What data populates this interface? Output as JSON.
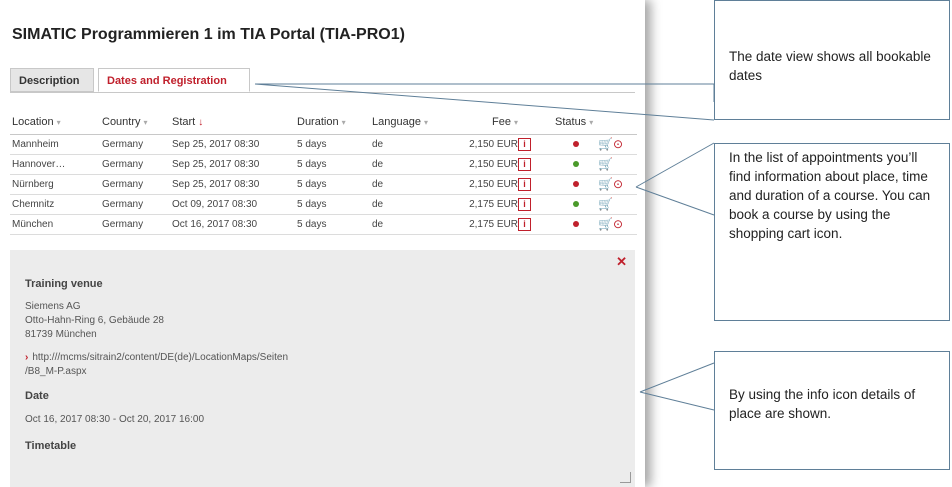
{
  "page_title": "SIMATIC Programmieren 1 im TIA Portal (TIA-PRO1)",
  "tabs": [
    {
      "label": "Description",
      "active": false
    },
    {
      "label": "Dates and Registration",
      "active": true
    }
  ],
  "table": {
    "headers": [
      "Location",
      "Country",
      "Start",
      "Duration",
      "Language",
      "Fee",
      "Status"
    ],
    "rows": [
      {
        "location": "Mannheim",
        "country": "Germany",
        "start": "Sep 25, 2017 08:30",
        "duration": "5 days",
        "language": "de",
        "fee": "2,150 EUR",
        "status_color": "#c0202c",
        "cart": "🛒⊙"
      },
      {
        "location": "Hannover…",
        "country": "Germany",
        "start": "Sep 25, 2017 08:30",
        "duration": "5 days",
        "language": "de",
        "fee": "2,150 EUR",
        "status_color": "#4a9a2a",
        "cart": "🛒"
      },
      {
        "location": "Nürnberg",
        "country": "Germany",
        "start": "Sep 25, 2017 08:30",
        "duration": "5 days",
        "language": "de",
        "fee": "2,150 EUR",
        "status_color": "#c0202c",
        "cart": "🛒⊙"
      },
      {
        "location": "Chemnitz",
        "country": "Germany",
        "start": "Oct 09, 2017 08:30",
        "duration": "5 days",
        "language": "de",
        "fee": "2,175 EUR",
        "status_color": "#4a9a2a",
        "cart": "🛒"
      },
      {
        "location": "München",
        "country": "Germany",
        "start": "Oct 16, 2017 08:30",
        "duration": "5 days",
        "language": "de",
        "fee": "2,175 EUR",
        "status_color": "#c0202c",
        "cart": "🛒⊙"
      }
    ]
  },
  "detail": {
    "venue_heading": "Training venue",
    "venue_lines": [
      "Siemens AG",
      "Otto-Hahn-Ring 6, Gebäude 28",
      "81739 München"
    ],
    "link_line1": "http:///mcms/sitrain2/content/DE(de)/LocationMaps/Seiten",
    "link_line2": "/B8_M-P.aspx",
    "date_heading": "Date",
    "date_value": "Oct 16, 2017 08:30 - Oct 20, 2017 16:00",
    "timetable_heading": "Timetable"
  },
  "callouts": [
    "The date view shows all bookable dates",
    "In the list of appointments you’ll find information about place, time and duration of a course. You can book a course by using the shopping cart icon.",
    "By using the info icon details of place are shown."
  ],
  "colors": {
    "accent": "#c0202c",
    "status_green": "#4a9a2a",
    "callout_border": "#5f7f98"
  }
}
